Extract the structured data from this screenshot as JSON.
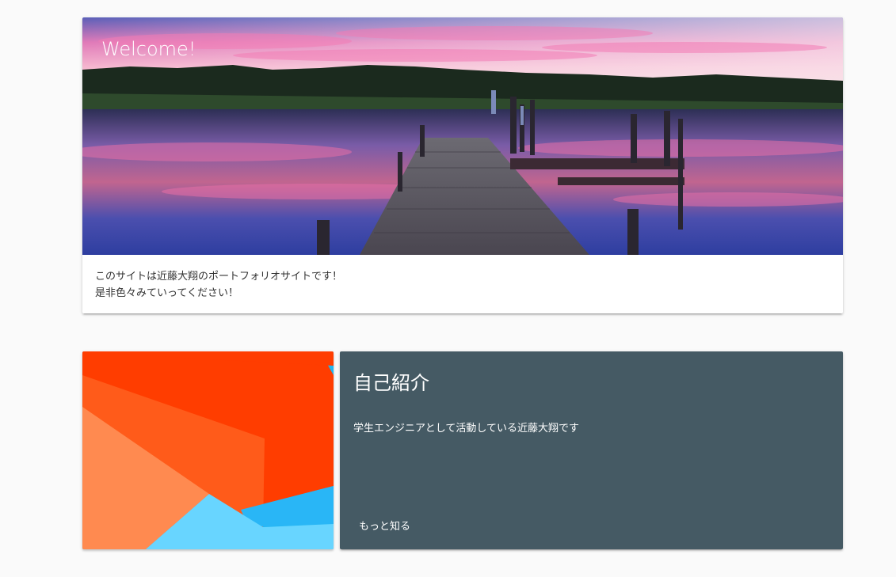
{
  "hero": {
    "title": "Welcome!",
    "lines": [
      "このサイトは近藤大翔のポートフォリオサイトです！",
      "是非色々みていってください！"
    ]
  },
  "about": {
    "title": "自己紹介",
    "text": "学生エンジニアとして活動している近藤大翔です",
    "action_label": "もっと知る",
    "background_color": "#455a64"
  },
  "colors": {
    "page_background": "#fafafa",
    "card_background": "#ffffff",
    "text_dark": "#333333"
  }
}
